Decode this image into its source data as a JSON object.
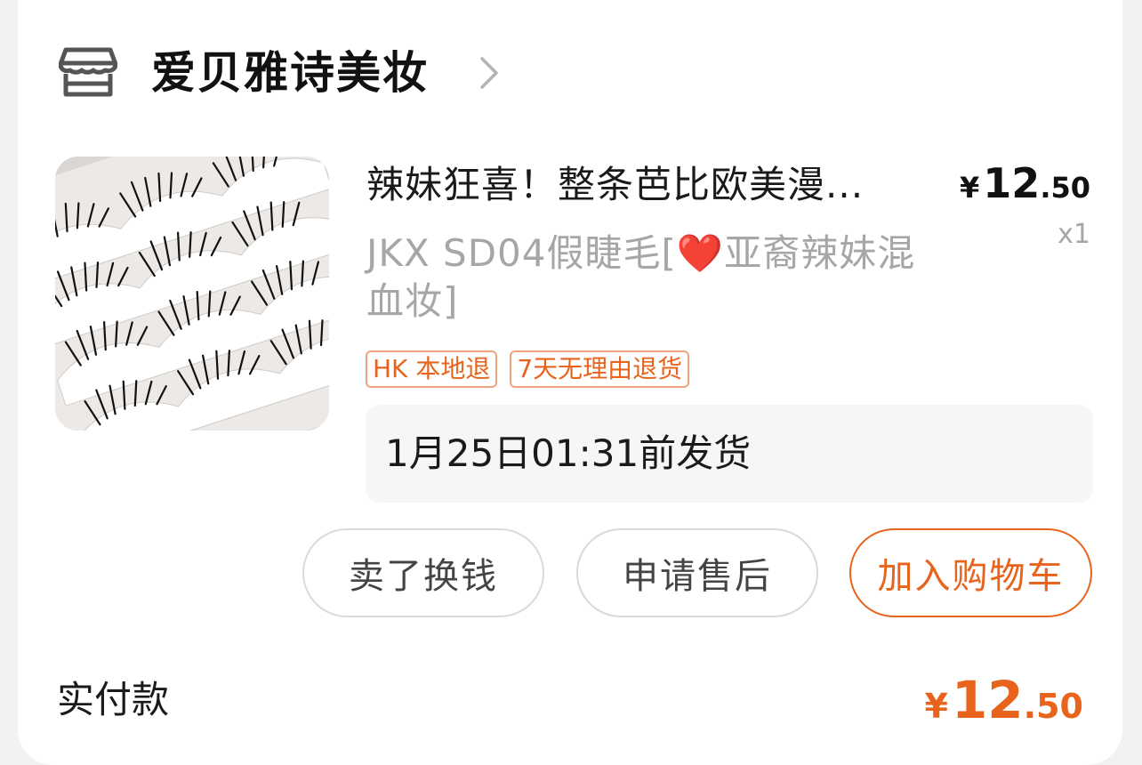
{
  "shop": {
    "name": "爱贝雅诗美妆",
    "icon": "store-icon"
  },
  "product": {
    "title": "辣妹狂喜！整条芭比欧美漫...",
    "price": {
      "currency": "¥",
      "integer": "12",
      "decimal": ".50"
    },
    "variant_before_emoji": "JKX SD04假睫毛[",
    "variant_emoji": "❤️",
    "variant_after_emoji": "亚裔辣妹混血妆]",
    "quantity": "x1",
    "image": "false-eyelashes-product-photo"
  },
  "tags": [
    "HK 本地退",
    "7天无理由退货"
  ],
  "shipping_note": "1月25日01:31前发货",
  "actions": {
    "sell_label": "卖了换钱",
    "aftersale_label": "申请售后",
    "cart_label": "加入购物车"
  },
  "payment": {
    "label": "实付款",
    "amount": {
      "currency": "¥",
      "integer": "12",
      "decimal": ".50"
    }
  },
  "colors": {
    "accent": "#e8641d",
    "muted_text": "#a6a6a6",
    "tag_border": "#f0a37d"
  }
}
